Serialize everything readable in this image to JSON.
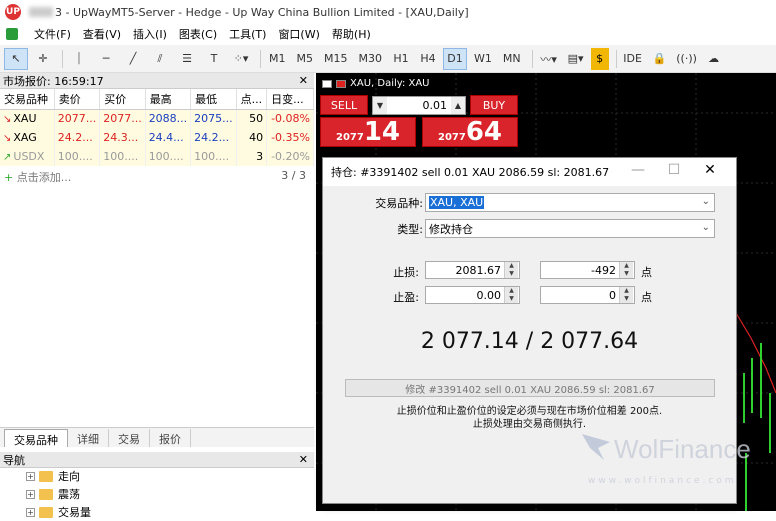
{
  "window": {
    "title_suffix": "3 - UpWayMT5-Server - Hedge - Up Way China Bullion Limited - [XAU,Daily]"
  },
  "menu": [
    "文件(F)",
    "查看(V)",
    "插入(I)",
    "图表(C)",
    "工具(T)",
    "窗口(W)",
    "帮助(H)"
  ],
  "toolbar": {
    "timeframes": [
      "M1",
      "M5",
      "M15",
      "M30",
      "H1",
      "H4",
      "D1",
      "W1",
      "MN"
    ],
    "active_timeframe": "D1",
    "ide_label": "IDE"
  },
  "market_watch": {
    "header": "市场报价: 16:59:17",
    "columns": [
      "交易品种",
      "卖价",
      "买价",
      "最高",
      "最低",
      "点...",
      "日变..."
    ],
    "rows": [
      {
        "symbol": "XAU",
        "bid": "2077...",
        "ask": "2077...",
        "high": "2088...",
        "low": "2075...",
        "spread": "50",
        "change": "-0.08%"
      },
      {
        "symbol": "XAG",
        "bid": "24.2...",
        "ask": "24.3...",
        "high": "24.4...",
        "low": "24.2...",
        "spread": "40",
        "change": "-0.35%"
      },
      {
        "symbol": "USDX",
        "bid": "100....",
        "ask": "100....",
        "high": "100....",
        "low": "100....",
        "spread": "3",
        "change": "-0.20%"
      }
    ],
    "add_label": "点击添加...",
    "count": "3 / 3",
    "tabs": [
      "交易品种",
      "详细",
      "交易",
      "报价"
    ]
  },
  "navigator": {
    "header": "导航",
    "items": [
      "走向",
      "震荡",
      "交易量"
    ]
  },
  "chart": {
    "label": "XAU, Daily: XAU",
    "sell_label": "SELL",
    "buy_label": "BUY",
    "lot": "0.01",
    "sell_small": "2077",
    "sell_big": "14",
    "buy_small": "2077",
    "buy_big": "64"
  },
  "dialog": {
    "title": "持仓: #3391402 sell 0.01 XAU 2086.59 sl: 2081.67",
    "symbol_label": "交易品种:",
    "symbol_value": "XAU, XAU",
    "type_label": "类型:",
    "type_value": "修改持仓",
    "sl_label": "止损:",
    "sl_price": "2081.67",
    "sl_points": "-492",
    "tp_label": "止盈:",
    "tp_price": "0.00",
    "tp_points": "0",
    "unit": "点",
    "quote": "2 077.14 / 2 077.64",
    "modify_button": "修改 #3391402 sell 0.01 XAU 2086.59 sl: 2081.67",
    "note_line1": "止损价位和止盈价位的设定必须与现在市场价位相差 200点.",
    "note_line2": "止损处理由交易商侧执行."
  },
  "watermark": {
    "brand": "WolFinance",
    "url": "www.wolfinance.com"
  }
}
